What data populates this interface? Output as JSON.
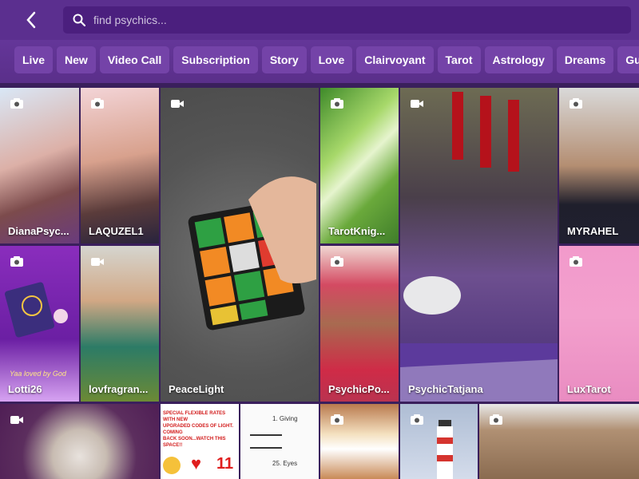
{
  "header": {
    "search_placeholder": "find psychics..."
  },
  "filters": [
    "Live",
    "New",
    "Video Call",
    "Subscription",
    "Story",
    "Love",
    "Clairvoyant",
    "Tarot",
    "Astrology",
    "Dreams",
    "Guides"
  ],
  "tiles": [
    {
      "name": "DianaPsyc...",
      "camera": "photo-camera-icon"
    },
    {
      "name": "LAQUZEL1",
      "camera": "photo-camera-icon"
    },
    {
      "name": "PeaceLight",
      "camera": "video-camera-icon"
    },
    {
      "name": "TarotKnig...",
      "camera": "photo-camera-icon"
    },
    {
      "name": "PsychicTatjana",
      "camera": "video-camera-icon"
    },
    {
      "name": "MYRAHEL",
      "camera": "photo-camera-icon"
    },
    {
      "name": "Lotti26",
      "camera": "photo-camera-icon"
    },
    {
      "name": "lovfragran...",
      "camera": "video-camera-icon"
    },
    {
      "name": "PsychicPo...",
      "camera": "photo-camera-icon"
    },
    {
      "name": "LuxTarot",
      "camera": "photo-camera-icon"
    }
  ],
  "tile_texts": {
    "lotti_caption": "Yaa loved by God",
    "rates_line1": "SPECIAL FLEXIBLE RATES WITH NEW",
    "rates_line2": "UPGRADED CODES OF LIGHT. COMING",
    "rates_line3": "BACK SOON...WATCH THIS SPACE!!",
    "rates_number": "11",
    "notes_line1": "1. Giving",
    "notes_line2": "25. Eyes"
  }
}
